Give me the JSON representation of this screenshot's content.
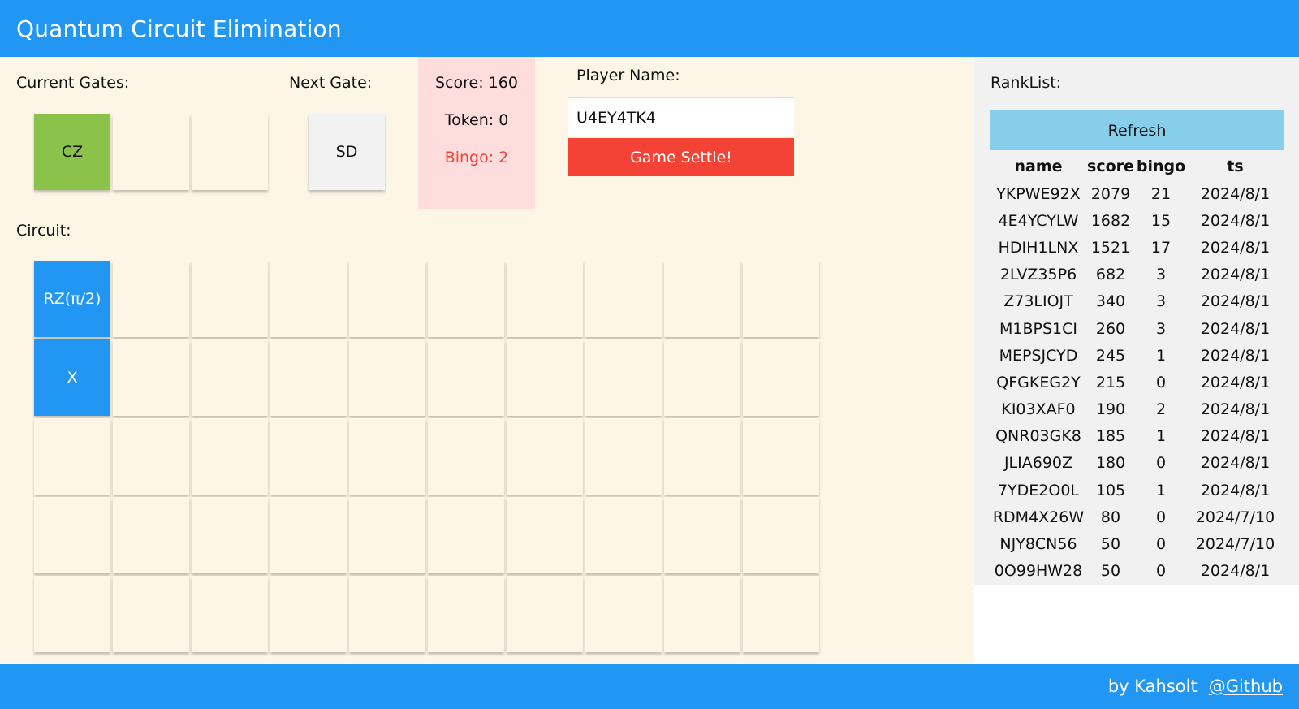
{
  "header": {
    "title": "Quantum Circuit Elimination"
  },
  "current_gates": {
    "label": "Current Gates:",
    "gates": [
      "CZ",
      "",
      ""
    ]
  },
  "next_gate": {
    "label": "Next Gate:",
    "gate": "SD"
  },
  "stats": {
    "score": "Score: 160",
    "token": "Token: 0",
    "bingo": "Bingo: 2"
  },
  "player": {
    "label": "Player Name:",
    "name": "U4EY4TK4",
    "settle_label": "Game Settle!"
  },
  "circuit": {
    "label": "Circuit:",
    "rows": [
      [
        "RZ(π/2)",
        "",
        "",
        "",
        "",
        "",
        "",
        "",
        "",
        ""
      ],
      [
        "X",
        "",
        "",
        "",
        "",
        "",
        "",
        "",
        "",
        ""
      ],
      [
        "",
        "",
        "",
        "",
        "",
        "",
        "",
        "",
        "",
        ""
      ],
      [
        "",
        "",
        "",
        "",
        "",
        "",
        "",
        "",
        "",
        ""
      ],
      [
        "",
        "",
        "",
        "",
        "",
        "",
        "",
        "",
        "",
        ""
      ]
    ]
  },
  "ranklist": {
    "label": "RankList:",
    "refresh_label": "Refresh",
    "columns": [
      "name",
      "score",
      "bingo",
      "ts"
    ],
    "rows": [
      [
        "YKPWE92X",
        "2079",
        "21",
        "2024/8/1"
      ],
      [
        "4E4YCYLW",
        "1682",
        "15",
        "2024/8/1"
      ],
      [
        "HDIH1LNX",
        "1521",
        "17",
        "2024/8/1"
      ],
      [
        "2LVZ35P6",
        "682",
        "3",
        "2024/8/1"
      ],
      [
        "Z73LIOJT",
        "340",
        "3",
        "2024/8/1"
      ],
      [
        "M1BPS1CI",
        "260",
        "3",
        "2024/8/1"
      ],
      [
        "MEPSJCYD",
        "245",
        "1",
        "2024/8/1"
      ],
      [
        "QFGKEG2Y",
        "215",
        "0",
        "2024/8/1"
      ],
      [
        "KI03XAF0",
        "190",
        "2",
        "2024/8/1"
      ],
      [
        "QNR03GK8",
        "185",
        "1",
        "2024/8/1"
      ],
      [
        "JLIA690Z",
        "180",
        "0",
        "2024/8/1"
      ],
      [
        "7YDE2O0L",
        "105",
        "1",
        "2024/8/1"
      ],
      [
        "RDM4X26W",
        "80",
        "0",
        "2024/7/10"
      ],
      [
        "NJY8CN56",
        "50",
        "0",
        "2024/7/10"
      ],
      [
        "0O99HW28",
        "50",
        "0",
        "2024/8/1"
      ]
    ]
  },
  "footer": {
    "credit": "by Kahsolt",
    "link_label": "@Github"
  },
  "colors": {
    "primary": "#2196f3",
    "background": "#fdf5e6",
    "gate_green": "#8bc34a",
    "gate_blue": "#2196f3",
    "settle_red": "#f44336",
    "refresh_blue": "#87ceeb",
    "score_pink": "#ffdddd"
  }
}
